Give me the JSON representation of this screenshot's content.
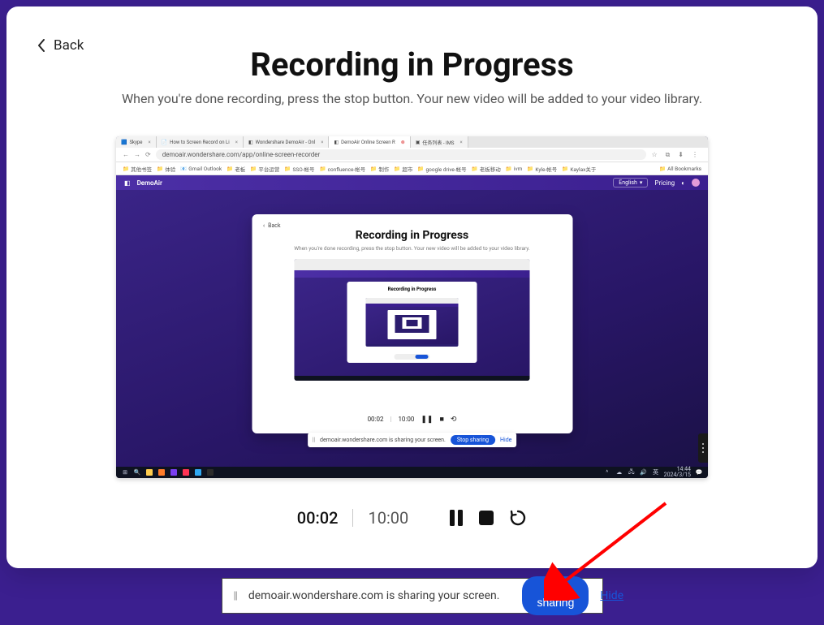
{
  "back_label": "Back",
  "title": "Recording in Progress",
  "subtitle": "When you're done recording, press the stop button. Your new video will be added to your video library.",
  "browser": {
    "tabs": [
      {
        "label": "Skype"
      },
      {
        "label": "How to Screen Record on Li"
      },
      {
        "label": "Wondershare DemoAir - Onl"
      },
      {
        "label": "DemoAir Online Screen R",
        "active": true
      },
      {
        "label": "任务列表 - IMS"
      }
    ],
    "url": "demoair.wondershare.com/app/online-screen-recorder",
    "bookmarks": [
      "其他书签",
      "体验",
      "Gmail Outlook",
      "老板",
      "平台运营",
      "SSO-帐号",
      "confluence-帐号",
      "制作",
      "超市",
      "google drive-帐号",
      "老板移动",
      "ivm",
      "Kyle-帐号",
      "Kaylax关于",
      "All Bookmarks"
    ],
    "app": {
      "brand": "DemoAir",
      "lang": "English",
      "pricing": "Pricing"
    },
    "nested": {
      "back": "Back",
      "title": "Recording in Progress",
      "subtitle": "When you're done recording, press the stop button. Your new video will be added to your video library.",
      "elapsed": "00:02",
      "max": "10:00",
      "lvl3_title": "Recording in Progress"
    },
    "share_pill": {
      "text": "demoair.wondershare.com is sharing your screen.",
      "stop": "Stop sharing",
      "hide": "Hide"
    },
    "taskbar_time": "14:44",
    "taskbar_date": "2024/3/15"
  },
  "controls": {
    "elapsed": "00:02",
    "max": "10:00"
  },
  "share_bar": {
    "text": "demoair.wondershare.com is sharing your screen.",
    "stop": "Stop sharing",
    "hide": "Hide"
  }
}
